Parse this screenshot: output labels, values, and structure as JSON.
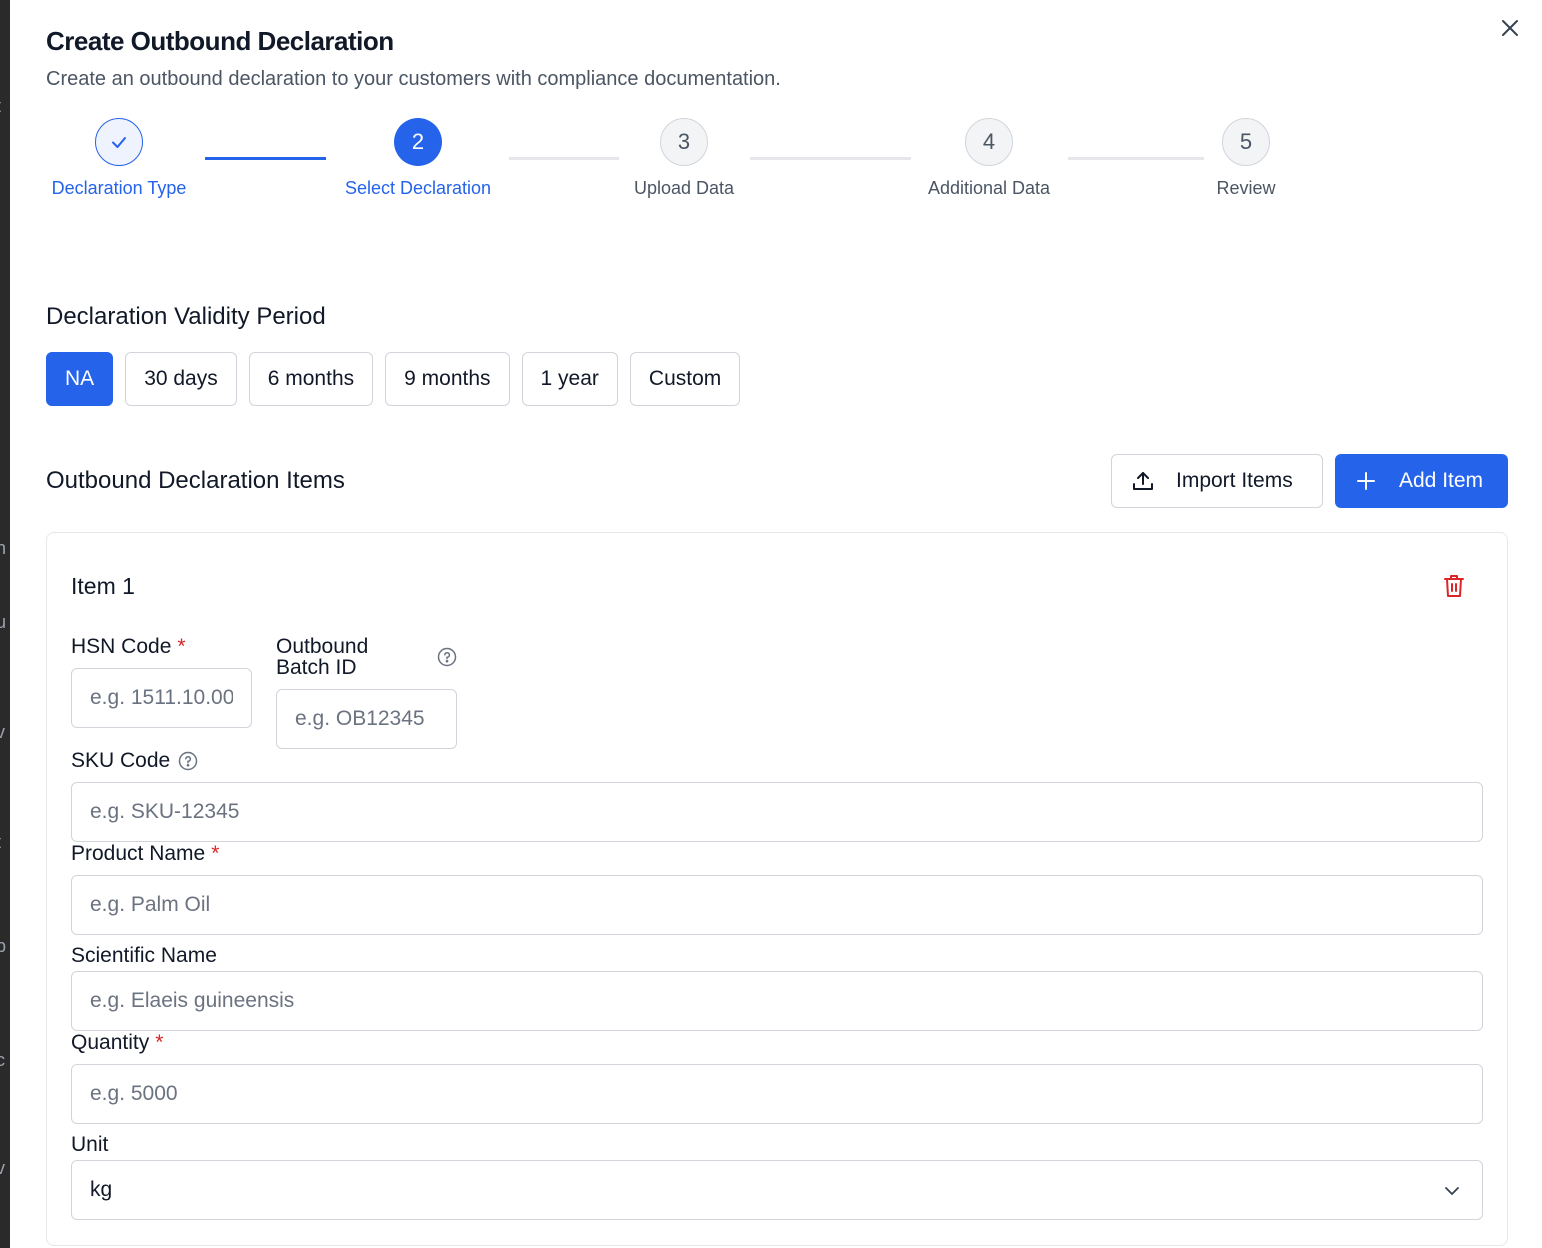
{
  "modal": {
    "title": "Create Outbound Declaration",
    "subtitle": "Create an outbound declaration to your customers with compliance documentation."
  },
  "stepper": {
    "steps": [
      {
        "number": "1",
        "label": "Declaration Type",
        "state": "completed"
      },
      {
        "number": "2",
        "label": "Select Declaration",
        "state": "active"
      },
      {
        "number": "3",
        "label": "Upload Data",
        "state": "upcoming"
      },
      {
        "number": "4",
        "label": "Additional Data",
        "state": "upcoming"
      },
      {
        "number": "5",
        "label": "Review",
        "state": "upcoming"
      }
    ]
  },
  "validity": {
    "title": "Declaration Validity Period",
    "options": [
      "NA",
      "30 days",
      "6 months",
      "9 months",
      "1 year",
      "Custom"
    ],
    "selected": "NA"
  },
  "items_section": {
    "title": "Outbound Declaration Items",
    "import_label": "Import Items",
    "add_label": "Add Item"
  },
  "item": {
    "title": "Item 1",
    "hsn": {
      "label": "HSN Code",
      "placeholder": "e.g. 1511.10.00",
      "required": true
    },
    "batch": {
      "label_line1": "Outbound",
      "label_line2": "Batch ID",
      "placeholder": "e.g. OB12345"
    },
    "sku": {
      "label": "SKU Code",
      "placeholder": "e.g. SKU-12345"
    },
    "product": {
      "label": "Product Name",
      "placeholder": "e.g. Palm Oil",
      "required": true
    },
    "scientific": {
      "label": "Scientific Name",
      "placeholder": "e.g. Elaeis guineensis"
    },
    "quantity": {
      "label": "Quantity",
      "placeholder": "e.g. 5000",
      "required": true
    },
    "unit": {
      "label": "Unit",
      "value": "kg"
    }
  },
  "required_marker": "*",
  "colors": {
    "primary": "#2563eb",
    "danger": "#dc2626",
    "border": "#d1d5db",
    "muted_text": "#4b5563"
  },
  "icons": [
    "close-icon",
    "check-icon",
    "upload-icon",
    "plus-icon",
    "trash-icon",
    "help-circle-icon",
    "chevron-down-icon"
  ]
}
